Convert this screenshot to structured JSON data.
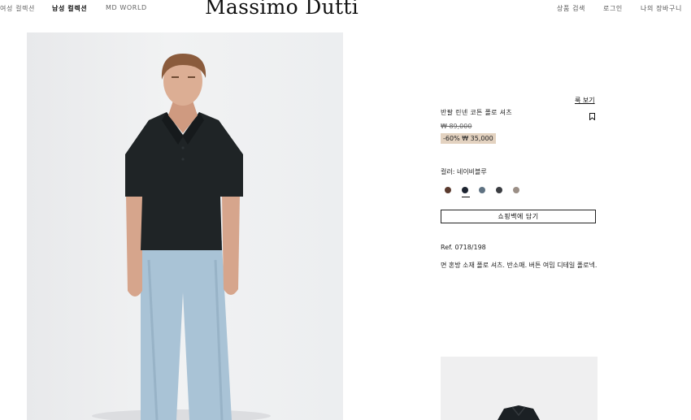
{
  "header": {
    "nav": [
      "여성 컬렉션",
      "남성 컬렉션",
      "MD WORLD"
    ],
    "active_nav": "남성 컬렉션",
    "logo": "Massimo Dutti",
    "utility": [
      "상품 검색",
      "로그인",
      "나의 장바구니"
    ]
  },
  "product": {
    "detail_link": "룩 보기",
    "name": "반팔 린넨 코튼 폴로 셔츠",
    "old_price": "₩ 89,000",
    "discount": "-60%",
    "price": "₩ 35,000",
    "color_label": "컬러: 네이비블루",
    "colors": [
      {
        "name": "brown",
        "hex": "#5a3a2e"
      },
      {
        "name": "navy",
        "hex": "#1d2430"
      },
      {
        "name": "slate-blue",
        "hex": "#5f7282"
      },
      {
        "name": "charcoal",
        "hex": "#3b3d42"
      },
      {
        "name": "taupe",
        "hex": "#9b8f86"
      }
    ],
    "selected_color_index": 1,
    "add_to_bag": "쇼핑백에 담기",
    "ref": "Ref. 0718/198",
    "description": "면 혼방 소재 폴로 셔츠. 반소매. 버튼 여밈 디테일 폴로넥."
  },
  "colors": {
    "accent_sale_bg": "#e3d2c0",
    "text": "#1a1a1a",
    "photo_bg": "#eceef0",
    "shirt": "#1f2426",
    "jeans": "#a9c3d6"
  }
}
